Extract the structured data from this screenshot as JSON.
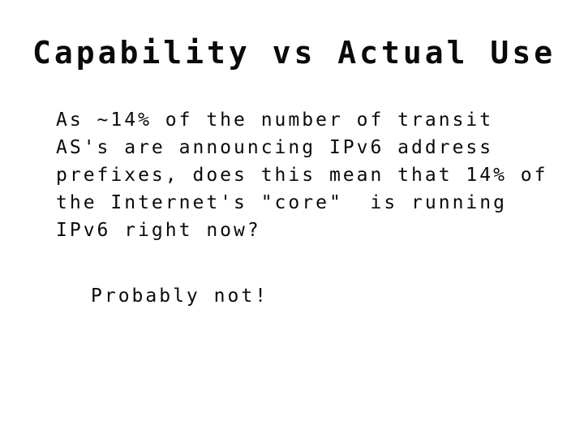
{
  "slide": {
    "title": "Capability vs Actual Use",
    "body_lines": [
      "As ~14% of the number of transit",
      "AS's are announcing IPv6 address",
      "prefixes, does this mean that 14% of",
      "the Internet's \"core\"  is running",
      "IPv6 right now?"
    ],
    "conclusion": "Probably not!",
    "colors": {
      "background": "#ffffff",
      "text": "#0a0a0a"
    }
  }
}
